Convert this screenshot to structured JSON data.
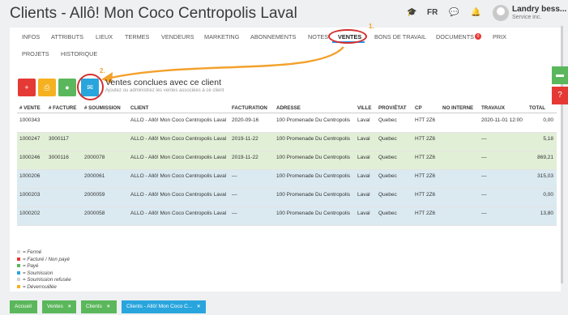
{
  "header": {
    "title": "Clients - Allô! Mon Coco Centropolis Laval",
    "lang": "FR",
    "user_name": "Landry bess... ▾",
    "user_sub": "Service inc."
  },
  "tabs": [
    "INFOS",
    "ATTRIBUTS",
    "LIEUX",
    "TERMES",
    "VENDEURS",
    "MARKETING",
    "ABONNEMENTS",
    "NOTES",
    "VENTES",
    "BONS DE TRAVAIL",
    "DOCUMENTS",
    "PRIX",
    "PROJETS",
    "HISTORIQUE"
  ],
  "active_tab": "VENTES",
  "documents_badge": "0",
  "annotations": {
    "step1": "1.",
    "step2": "2."
  },
  "actions": {
    "add": "+",
    "print": "⎙",
    "comment": "●",
    "email": "✉"
  },
  "section": {
    "title": "Ventes conclues avec ce client",
    "subtitle": "Ajoutez ou administrez les ventes associées à ce client"
  },
  "table": {
    "columns": [
      "# VENTE",
      "# FACTURE",
      "# SOUMISSION",
      "CLIENT",
      "FACTURATION",
      "ADRESSE",
      "VILLE",
      "PROV/ÉTAT",
      "CP",
      "NO INTERNE",
      "TRAVAUX",
      "TOTAL"
    ],
    "rows": [
      {
        "vente": "1000343",
        "facture": "",
        "soumission": "",
        "client": "ALLO - Allô! Mon Coco Centropolis Laval",
        "facturation": "2020-09-16",
        "adresse": "100 Promenade Du Centropolis",
        "ville": "Laval",
        "prov": "Quebec",
        "cp": "H7T 2Z6",
        "interne": "",
        "travaux": "2020-11-01 12:00",
        "total": "0,00",
        "status": "Fermé"
      },
      {
        "vente": "1000247",
        "facture": "3000117",
        "soumission": "",
        "client": "ALLO - Allô! Mon Coco Centropolis Laval",
        "facturation": "2019-11-22",
        "adresse": "100 Promenade Du Centropolis",
        "ville": "Laval",
        "prov": "Quebec",
        "cp": "H7T 2Z6",
        "interne": "",
        "travaux": "—",
        "total": "5,18",
        "status": "Payé"
      },
      {
        "vente": "1000246",
        "facture": "3000116",
        "soumission": "2000078",
        "client": "ALLO - Allô! Mon Coco Centropolis Laval",
        "facturation": "2019-11-22",
        "adresse": "100 Promenade Du Centropolis",
        "ville": "Laval",
        "prov": "Quebec",
        "cp": "H7T 2Z6",
        "interne": "",
        "travaux": "—",
        "total": "869,21",
        "status": "Payé"
      },
      {
        "vente": "1000206",
        "facture": "",
        "soumission": "2000061",
        "client": "ALLO - Allô! Mon Coco Centropolis Laval",
        "facturation": "—",
        "adresse": "100 Promenade Du Centropolis",
        "ville": "Laval",
        "prov": "Quebec",
        "cp": "H7T 2Z6",
        "interne": "",
        "travaux": "—",
        "total": "315,03",
        "status": "Soumission"
      },
      {
        "vente": "1000203",
        "facture": "",
        "soumission": "2000059",
        "client": "ALLO - Allô! Mon Coco Centropolis Laval",
        "facturation": "—",
        "adresse": "100 Promenade Du Centropolis",
        "ville": "Laval",
        "prov": "Quebec",
        "cp": "H7T 2Z6",
        "interne": "",
        "travaux": "—",
        "total": "0,00",
        "status": "Soumission"
      },
      {
        "vente": "1000202",
        "facture": "",
        "soumission": "2000058",
        "client": "ALLO - Allô! Mon Coco Centropolis Laval",
        "facturation": "—",
        "adresse": "100 Promenade Du Centropolis",
        "ville": "Laval",
        "prov": "Quebec",
        "cp": "H7T 2Z6",
        "interne": "",
        "travaux": "—",
        "total": "13,80",
        "status": "Soumission"
      }
    ]
  },
  "legend": [
    {
      "label": "= Fermé",
      "color": "#d3d3d3"
    },
    {
      "label": "= Facturé / Non payé",
      "color": "#e53935"
    },
    {
      "label": "= Payé",
      "color": "#5bb75b"
    },
    {
      "label": "= Soumission",
      "color": "#29a5dd"
    },
    {
      "label": "= Soumission refusée",
      "color": "#d3d3d3"
    },
    {
      "label": "= Déverrouillée",
      "color": "#f5b120"
    }
  ],
  "colors": {
    "Fermé": "#ffffff",
    "Payé": "#e2efd7",
    "Soumission": "#dbeaf1",
    "accent": "#2196f3"
  },
  "side": {
    "chat": "▬",
    "help": "?"
  },
  "taskbar": [
    {
      "label": "Accueil",
      "color": "#5bb75b",
      "closable": false
    },
    {
      "label": "Ventes",
      "color": "#5bb75b",
      "closable": true
    },
    {
      "label": "Clients",
      "color": "#5bb75b",
      "closable": true
    },
    {
      "label": "Clients - Allô! Mon Coco C...",
      "color": "#29a5dd",
      "closable": true
    }
  ]
}
